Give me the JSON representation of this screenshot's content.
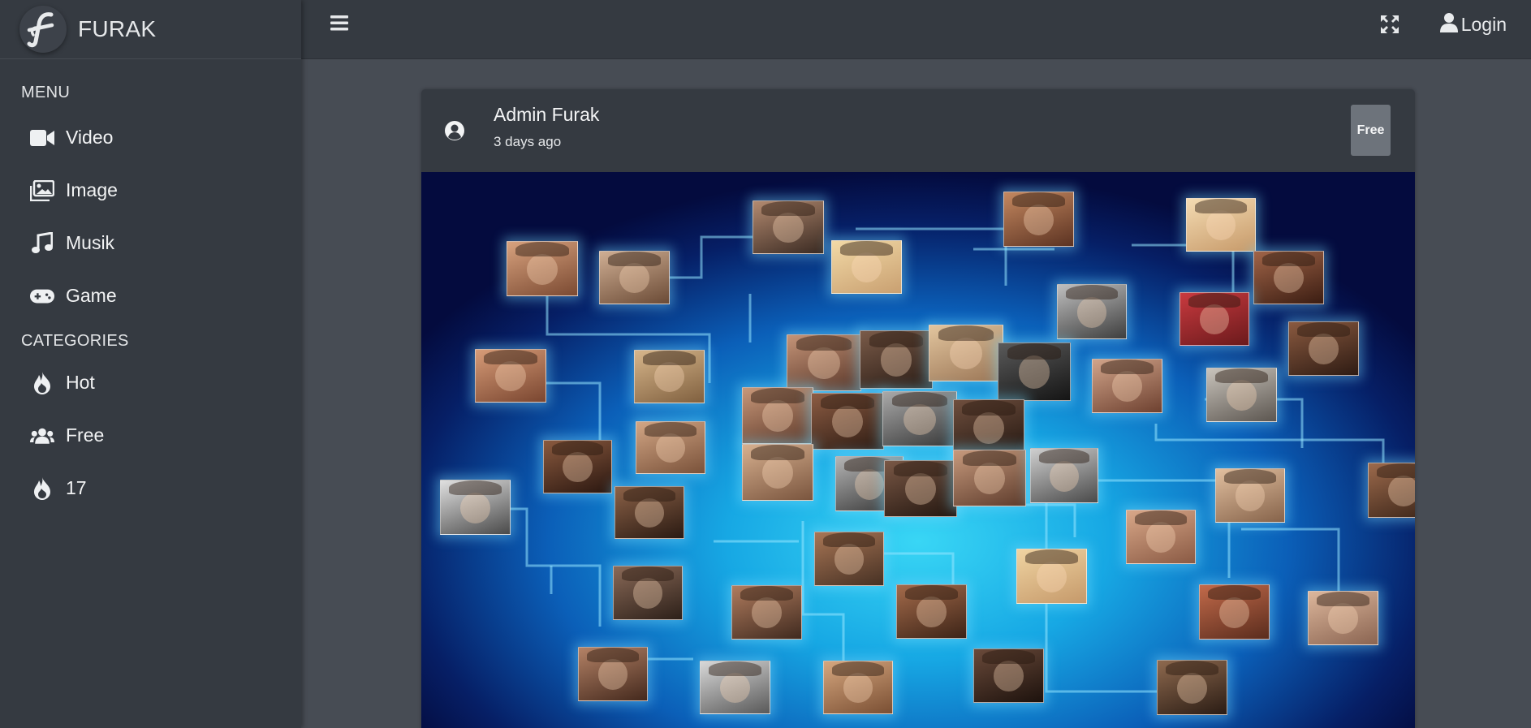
{
  "brand": {
    "name": "FURAK"
  },
  "sidebar": {
    "menu_header": "MENU",
    "menu_items": [
      {
        "label": "Video",
        "icon": "video-camera-icon"
      },
      {
        "label": "Image",
        "icon": "images-icon"
      },
      {
        "label": "Musik",
        "icon": "music-note-icon"
      },
      {
        "label": "Game",
        "icon": "gamepad-icon"
      }
    ],
    "categories_header": "CATEGORIES",
    "category_items": [
      {
        "label": "Hot",
        "icon": "fire-icon"
      },
      {
        "label": "Free",
        "icon": "users-icon"
      },
      {
        "label": "17",
        "icon": "fire-icon"
      }
    ]
  },
  "topbar": {
    "menu_toggle_icon": "hamburger-menu-icon",
    "fullscreen_icon": "expand-arrows-icon",
    "login_label": "Login"
  },
  "post": {
    "author": "Admin Furak",
    "time": "3 days ago",
    "badge": "Free",
    "media_description_icon": "social-network-faces-image"
  },
  "colors": {
    "sidebar_bg": "#353a41",
    "content_bg": "#474c54",
    "badge_bg": "#6d737b",
    "image_glow": "#39d6f5"
  }
}
